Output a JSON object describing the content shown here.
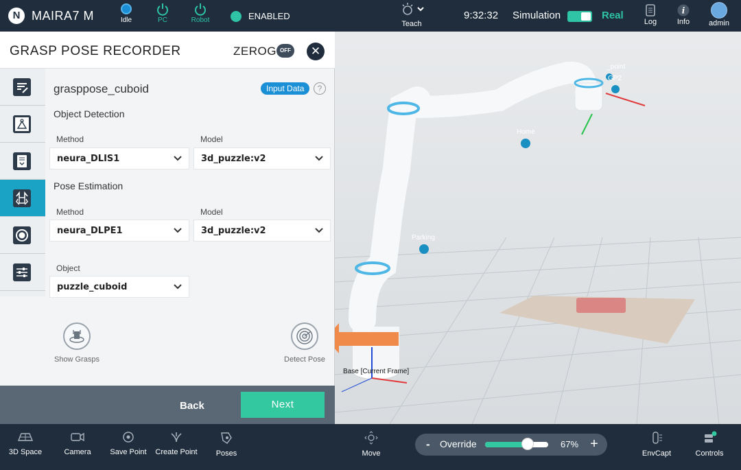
{
  "topbar": {
    "logo": "N",
    "device_name": "MAIRA7 M",
    "status": [
      {
        "label": "Idle",
        "color": "#1b8fd6"
      },
      {
        "label": "PC",
        "color": "#2ec4a5"
      },
      {
        "label": "Robot",
        "color": "#2ec4a5"
      }
    ],
    "enabled_label": "ENABLED",
    "teach_label": "Teach",
    "clock": "9:32:32",
    "simulation_label": "Simulation",
    "real_label": "Real",
    "log_label": "Log",
    "info_label": "Info",
    "user_label": "admin"
  },
  "panel": {
    "title": "GRASP POSE RECORDER",
    "zerog_label": "ZEROG:",
    "zerog_state": "OFF",
    "close_icon": "✕",
    "recipe_name": "grasppose_cuboid",
    "input_data_label": "Input Data",
    "help_icon": "?",
    "object_detection": {
      "heading": "Object Detection",
      "method_label": "Method",
      "method_value": "neura_DLIS1",
      "model_label": "Model",
      "model_value": "3d_puzzle:v2"
    },
    "pose_estimation": {
      "heading": "Pose Estimation",
      "method_label": "Method",
      "method_value": "neura_DLPE1",
      "model_label": "Model",
      "model_value": "3d_puzzle:v2"
    },
    "object": {
      "label": "Object",
      "value": "puzzle_cuboid"
    },
    "show_grasps_label": "Show Grasps",
    "detect_pose_label": "Detect Pose",
    "back_label": "Back",
    "next_label": "Next"
  },
  "scene": {
    "points": [
      {
        "label": "Home"
      },
      {
        "label": "Parking"
      },
      {
        "label": "GP2"
      },
      {
        "label": "_point"
      }
    ],
    "base_label": "Base [Current Frame]"
  },
  "bottombar": {
    "items": [
      {
        "label": "3D Space"
      },
      {
        "label": "Camera"
      },
      {
        "label": "Save Point"
      },
      {
        "label": "Create Point"
      },
      {
        "label": "Poses"
      },
      {
        "label": "Move"
      }
    ],
    "override_minus": "-",
    "override_label": "Override",
    "override_value": "67%",
    "override_fraction": 0.67,
    "override_plus": "+",
    "envcapt_label": "EnvCapt",
    "controls_label": "Controls"
  },
  "colors": {
    "accent": "#34c8a0",
    "blue": "#1b8fd6",
    "nav_active": "#1aa3c5",
    "arrow": "#f08a4b"
  }
}
